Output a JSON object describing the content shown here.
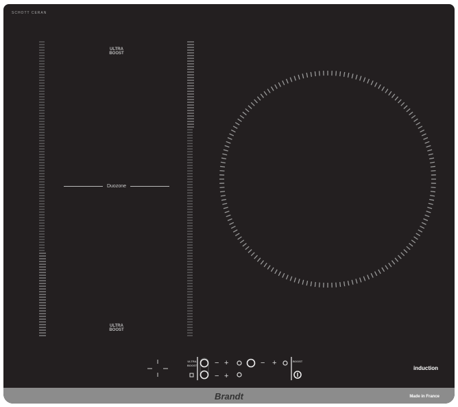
{
  "logo_text": "SCHOTT CERAN",
  "zones": {
    "top_boost": "ULTRA BOOST",
    "bottom_boost": "ULTRA BOOST",
    "duozone_label": "Duozone"
  },
  "controls": {
    "minus": "−",
    "plus": "+",
    "boost": "BOOST",
    "ultra_boost": "ULTRA BOOST"
  },
  "induction_label": "induction",
  "brand": "Brandt",
  "made_in": "Made in France",
  "colors": {
    "glass": "#231f20",
    "strip": "#8c8c8c"
  }
}
